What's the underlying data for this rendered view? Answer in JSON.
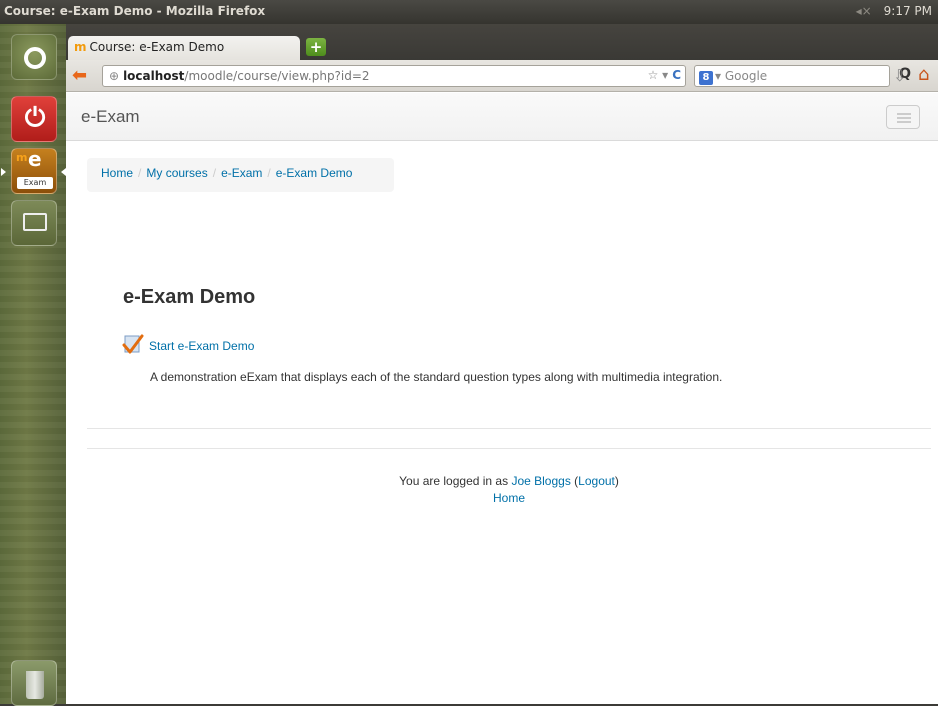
{
  "system": {
    "window_title": "Course: e-Exam Demo - Mozilla Firefox",
    "volume": "◂×",
    "clock": "9:17 PM"
  },
  "launcher": {
    "items": [
      {
        "name": "ubuntu-dash"
      },
      {
        "name": "power"
      },
      {
        "name": "e-exam-app",
        "letter_m": "m",
        "letter_e": "e",
        "label": "Exam"
      },
      {
        "name": "window"
      },
      {
        "name": "trash"
      }
    ]
  },
  "browser": {
    "tab_title": "Course: e-Exam Demo",
    "tab_favicon": "m",
    "url_host": "localhost",
    "url_path": "/moodle/course/view.php?id=2",
    "search_engine": "Google",
    "search_placeholder": "Google"
  },
  "site": {
    "brand": "e-Exam",
    "breadcrumb": [
      "Home",
      "My courses",
      "e-Exam",
      "e-Exam Demo"
    ],
    "breadcrumb_sep": "/"
  },
  "course": {
    "title": "e-Exam Demo",
    "activity_link": "Start e-Exam Demo",
    "activity_description": "A demonstration eExam that displays each of the standard question types along with multimedia integration."
  },
  "footer": {
    "logged_in_prefix": "You are logged in as",
    "user_name": "Joe Bloggs",
    "logout_open": "(",
    "logout_label": "Logout",
    "logout_close": ")",
    "home_link": "Home"
  },
  "colors": {
    "link": "#0070a8",
    "launcher_power": "#d0322d",
    "exam_accent": "#f7a21b"
  }
}
